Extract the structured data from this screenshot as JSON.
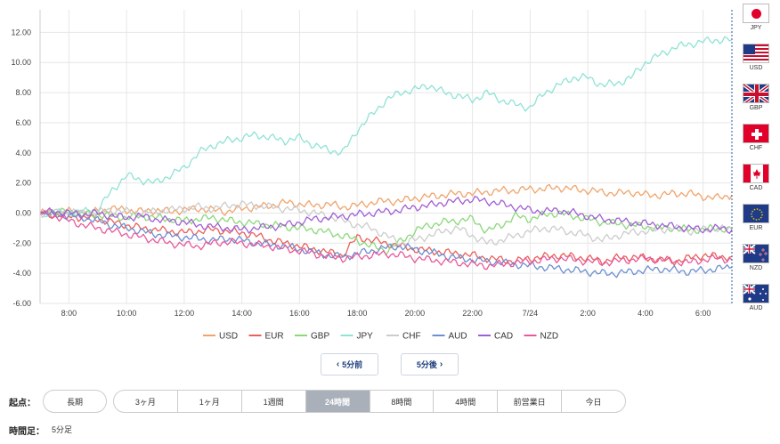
{
  "chart_data": {
    "type": "line",
    "x_ticks": [
      "8:00",
      "10:00",
      "12:00",
      "14:00",
      "16:00",
      "18:00",
      "20:00",
      "22:00",
      "7/24",
      "2:00",
      "4:00",
      "6:00"
    ],
    "y_ticks": [
      "12.00",
      "10.00",
      "8.00",
      "6.00",
      "4.00",
      "2.00",
      "0.00",
      "-2.00",
      "-4.00",
      "-6.00"
    ],
    "ylim": [
      -6,
      13.5
    ],
    "x_hours": [
      0,
      0.5,
      1,
      1.5,
      2,
      2.5,
      3,
      3.5,
      4,
      4.5,
      5,
      5.5,
      6,
      6.5,
      7,
      7.5,
      8,
      8.5,
      9,
      9.5,
      10,
      10.5,
      11,
      11.5,
      12,
      12.5,
      13,
      13.5,
      14,
      14.5,
      15,
      15.5,
      16,
      16.5,
      17,
      17.5,
      18,
      18.5,
      19,
      19.5,
      20,
      20.5,
      21,
      21.5,
      22,
      22.5,
      23,
      23.5,
      24
    ],
    "x_start": "7:00",
    "series": [
      {
        "name": "USD",
        "color": "#f0a46b",
        "values": [
          0,
          0.1,
          0.1,
          0,
          0.1,
          0.3,
          0.2,
          0.1,
          0.2,
          0.1,
          0.2,
          0.3,
          0.2,
          0.1,
          0.3,
          0.4,
          0.5,
          0.7,
          0.6,
          0.5,
          0.6,
          0.4,
          0.5,
          0.7,
          0.8,
          0.8,
          1.0,
          1.1,
          1.2,
          1.3,
          1.3,
          1.4,
          1.5,
          1.5,
          1.6,
          1.6,
          1.7,
          1.6,
          1.5,
          1.4,
          1.3,
          1.4,
          1.2,
          1.2,
          1.3,
          1.3,
          1.1,
          1.0,
          1.2
        ]
      },
      {
        "name": "EUR",
        "color": "#e8615a",
        "values": [
          0,
          -0.1,
          -0.2,
          -0.3,
          -0.4,
          -0.6,
          -0.8,
          -1.0,
          -1.1,
          -1.2,
          -1.3,
          -1.2,
          -1.1,
          -1.2,
          -1.3,
          -1.5,
          -1.8,
          -2.0,
          -2.2,
          -2.4,
          -2.6,
          -2.8,
          -1.6,
          -1.8,
          -2.0,
          -2.2,
          -2.4,
          -2.5,
          -2.6,
          -2.7,
          -2.8,
          -3.0,
          -3.1,
          -3.2,
          -3.0,
          -2.9,
          -2.8,
          -2.9,
          -3.0,
          -3.2,
          -3.0,
          -2.9,
          -3.0,
          -3.1,
          -3.2,
          -3.0,
          -2.8,
          -2.9,
          -2.9
        ]
      },
      {
        "name": "GBP",
        "color": "#8bd87a",
        "values": [
          0,
          0,
          0.1,
          0,
          -0.1,
          -0.2,
          -0.3,
          -0.2,
          -0.3,
          -0.4,
          -0.5,
          -0.4,
          -0.3,
          -0.5,
          -0.6,
          -0.7,
          -0.8,
          -0.9,
          -1.0,
          -1.1,
          -1.3,
          -1.5,
          -1.8,
          -2.2,
          -2.5,
          -1.9,
          -1.2,
          -0.8,
          -0.6,
          -0.5,
          -0.4,
          -1.2,
          -0.8,
          -0.2,
          -0.4,
          -0.1,
          0,
          -0.2,
          -0.4,
          -0.6,
          -0.7,
          -0.8,
          -0.9,
          -1.0,
          -1.0,
          -1.1,
          -1.1,
          -1.0,
          -1.1
        ]
      },
      {
        "name": "JPY",
        "color": "#8fe3d5",
        "values": [
          0,
          0,
          0,
          0.1,
          0.2,
          1.5,
          2.5,
          2.2,
          2.0,
          2.5,
          3.0,
          4.0,
          4.5,
          4.8,
          5.0,
          5.2,
          5.0,
          4.8,
          5.0,
          4.5,
          4.2,
          4.0,
          5.5,
          6.5,
          7.5,
          8.0,
          8.2,
          8.5,
          8.0,
          7.8,
          7.5,
          8.0,
          7.5,
          7.2,
          7.0,
          8.0,
          8.5,
          9.0,
          9.0,
          8.5,
          8.6,
          9.0,
          10.0,
          10.5,
          11.0,
          11.2,
          11.4,
          11.5,
          11.5
        ]
      },
      {
        "name": "CHF",
        "color": "#cccccc",
        "values": [
          0,
          0,
          0.1,
          0,
          0.1,
          0.2,
          0.1,
          0,
          0.1,
          0.2,
          0.3,
          0.4,
          0.3,
          0.5,
          0.6,
          0.5,
          0.4,
          0.3,
          0.2,
          0,
          -0.2,
          -0.5,
          -0.8,
          -1.0,
          -1.5,
          -2.0,
          -1.8,
          -1.5,
          -1.2,
          -1.0,
          -1.5,
          -2.0,
          -1.8,
          -1.5,
          -1.2,
          -1.0,
          -1.1,
          -1.3,
          -1.5,
          -1.8,
          -1.5,
          -1.3,
          -1.2,
          -1.1,
          -1.0,
          -1.2,
          -1.1,
          -1.0,
          -1.1
        ]
      },
      {
        "name": "AUD",
        "color": "#6d8fd1",
        "values": [
          0,
          -0.1,
          -0.2,
          -0.3,
          -0.5,
          -0.8,
          -1.0,
          -1.2,
          -1.4,
          -1.5,
          -1.6,
          -1.7,
          -1.8,
          -1.7,
          -1.8,
          -2.0,
          -2.1,
          -2.2,
          -2.4,
          -2.6,
          -2.8,
          -2.9,
          -2.7,
          -2.5,
          -2.3,
          -2.2,
          -2.4,
          -2.6,
          -2.8,
          -3.0,
          -3.1,
          -3.2,
          -3.3,
          -3.4,
          -3.5,
          -3.6,
          -3.7,
          -3.8,
          -3.9,
          -4.0,
          -4.0,
          -3.9,
          -3.8,
          -3.7,
          -3.8,
          -3.9,
          -3.8,
          -3.7,
          -3.6
        ]
      },
      {
        "name": "CAD",
        "color": "#a15fd4",
        "values": [
          0,
          0.1,
          0,
          -0.1,
          0,
          -0.2,
          -0.3,
          -0.2,
          -0.4,
          -0.5,
          -0.6,
          -0.8,
          -0.9,
          -1.0,
          -1.1,
          -1.0,
          -0.9,
          -0.8,
          -0.6,
          -0.4,
          -0.3,
          -0.2,
          -0.1,
          0,
          0.1,
          0.2,
          0.4,
          0.5,
          0.7,
          0.8,
          0.9,
          0.8,
          0.6,
          0.4,
          0.2,
          0.1,
          0.2,
          0,
          -0.2,
          -0.4,
          -0.5,
          -0.6,
          -0.7,
          -0.8,
          -0.9,
          -1.0,
          -1.1,
          -1.0,
          -1.1
        ]
      },
      {
        "name": "NZD",
        "color": "#e85a9c",
        "values": [
          0,
          -0.2,
          -0.5,
          -0.8,
          -1.0,
          -1.2,
          -1.4,
          -1.6,
          -1.8,
          -2.0,
          -2.1,
          -2.2,
          -2.0,
          -1.9,
          -2.0,
          -2.1,
          -2.2,
          -2.4,
          -2.5,
          -2.7,
          -2.9,
          -3.0,
          -2.9,
          -2.8,
          -2.7,
          -2.8,
          -3.0,
          -3.1,
          -3.2,
          -3.3,
          -3.4,
          -3.5,
          -3.4,
          -3.3,
          -3.2,
          -3.1,
          -3.0,
          -3.1,
          -3.2,
          -3.3,
          -3.2,
          -3.1,
          -3.0,
          -3.1,
          -3.2,
          -3.3,
          -3.1,
          -3.0,
          -3.1
        ]
      }
    ],
    "legend_position": "bottom-center",
    "grid": true
  },
  "flags": [
    {
      "code": "JPY",
      "icon": "japan-flag-icon"
    },
    {
      "code": "USD",
      "icon": "usa-flag-icon"
    },
    {
      "code": "GBP",
      "icon": "uk-flag-icon"
    },
    {
      "code": "CHF",
      "icon": "switzerland-flag-icon"
    },
    {
      "code": "CAD",
      "icon": "canada-flag-icon"
    },
    {
      "code": "EUR",
      "icon": "eu-flag-icon"
    },
    {
      "code": "NZD",
      "icon": "newzealand-flag-icon"
    },
    {
      "code": "AUD",
      "icon": "australia-flag-icon"
    }
  ],
  "nav": {
    "prev_label": "5分前",
    "next_label": "5分後"
  },
  "period": {
    "label": "起点：",
    "long_label": "長期",
    "options": [
      "3ヶ月",
      "1ヶ月",
      "1週間",
      "24時間",
      "8時間",
      "4時間",
      "前営業日",
      "今日"
    ],
    "active": "24時間"
  },
  "timeframe": {
    "label": "時間足：",
    "value": "5分足"
  }
}
